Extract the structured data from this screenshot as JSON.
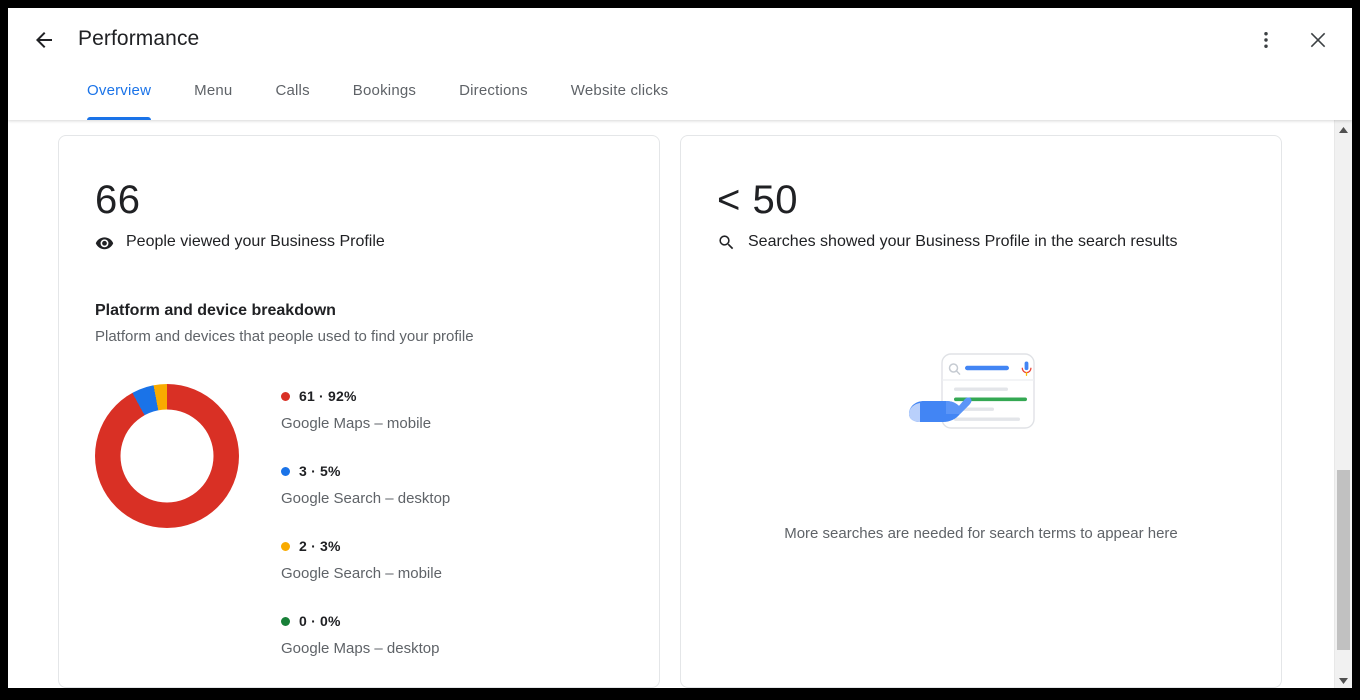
{
  "window": {
    "title": "Performance",
    "back_icon": "arrow-left-icon",
    "more_icon": "more-vertical-icon",
    "close_icon": "close-icon"
  },
  "tabs": [
    {
      "label": "Overview",
      "active": true
    },
    {
      "label": "Menu",
      "active": false
    },
    {
      "label": "Calls",
      "active": false
    },
    {
      "label": "Bookings",
      "active": false
    },
    {
      "label": "Directions",
      "active": false
    },
    {
      "label": "Website clicks",
      "active": false
    }
  ],
  "cards": {
    "views": {
      "metric_value": "66",
      "metric_icon": "eye-icon",
      "metric_label": "People viewed your Business Profile",
      "section_title": "Platform and device breakdown",
      "section_subtitle": "Platform and devices that people used to find your profile"
    },
    "searches": {
      "metric_value": "< 50",
      "metric_icon": "search-icon",
      "metric_label": "Searches showed your Business Profile in the search results",
      "illustration": "search-results-hand-illustration",
      "empty_message": "More searches are needed for search terms to appear here"
    }
  },
  "chart_data": {
    "type": "pie",
    "title": "Platform and device breakdown",
    "subtitle": "Platform and devices that people used to find your profile",
    "variant": "donut",
    "total": 66,
    "legend_position": "right",
    "categories": [
      "Google Maps – mobile",
      "Google Search – desktop",
      "Google Search – mobile",
      "Google Maps – desktop"
    ],
    "values": [
      61,
      3,
      2,
      0
    ],
    "percents": [
      92,
      5,
      3,
      0
    ],
    "colors": [
      "#d93025",
      "#1a73e8",
      "#f9ab00",
      "#188038"
    ],
    "labels": [
      "61 · 92%",
      "3 · 5%",
      "2 · 3%",
      "0 · 0%"
    ],
    "segments": [
      {
        "label": "61 · 92%",
        "name": "Google Maps – mobile",
        "value": 61,
        "percent": 92,
        "color": "#d93025"
      },
      {
        "label": "3 · 5%",
        "name": "Google Search – desktop",
        "value": 3,
        "percent": 5,
        "color": "#1a73e8"
      },
      {
        "label": "2 · 3%",
        "name": "Google Search – mobile",
        "value": 2,
        "percent": 3,
        "color": "#f9ab00"
      },
      {
        "label": "0 · 0%",
        "name": "Google Maps – desktop",
        "value": 0,
        "percent": 0,
        "color": "#188038"
      }
    ],
    "gradient": "conic-gradient(from 0deg, #d93025 0deg 331.2deg, #1a73e8 331.2deg 349.2deg, #f9ab00 349.2deg 360deg)"
  },
  "scrollbar": {
    "up_icon": "triangle-up-icon",
    "down_icon": "triangle-down-icon",
    "thumb": "scrollbar-thumb"
  },
  "colors": {
    "accent": "#1a73e8",
    "text_primary": "#202124",
    "text_secondary": "#5f6368",
    "red": "#d93025",
    "blue": "#1a73e8",
    "yellow": "#f9ab00",
    "green": "#188038"
  }
}
